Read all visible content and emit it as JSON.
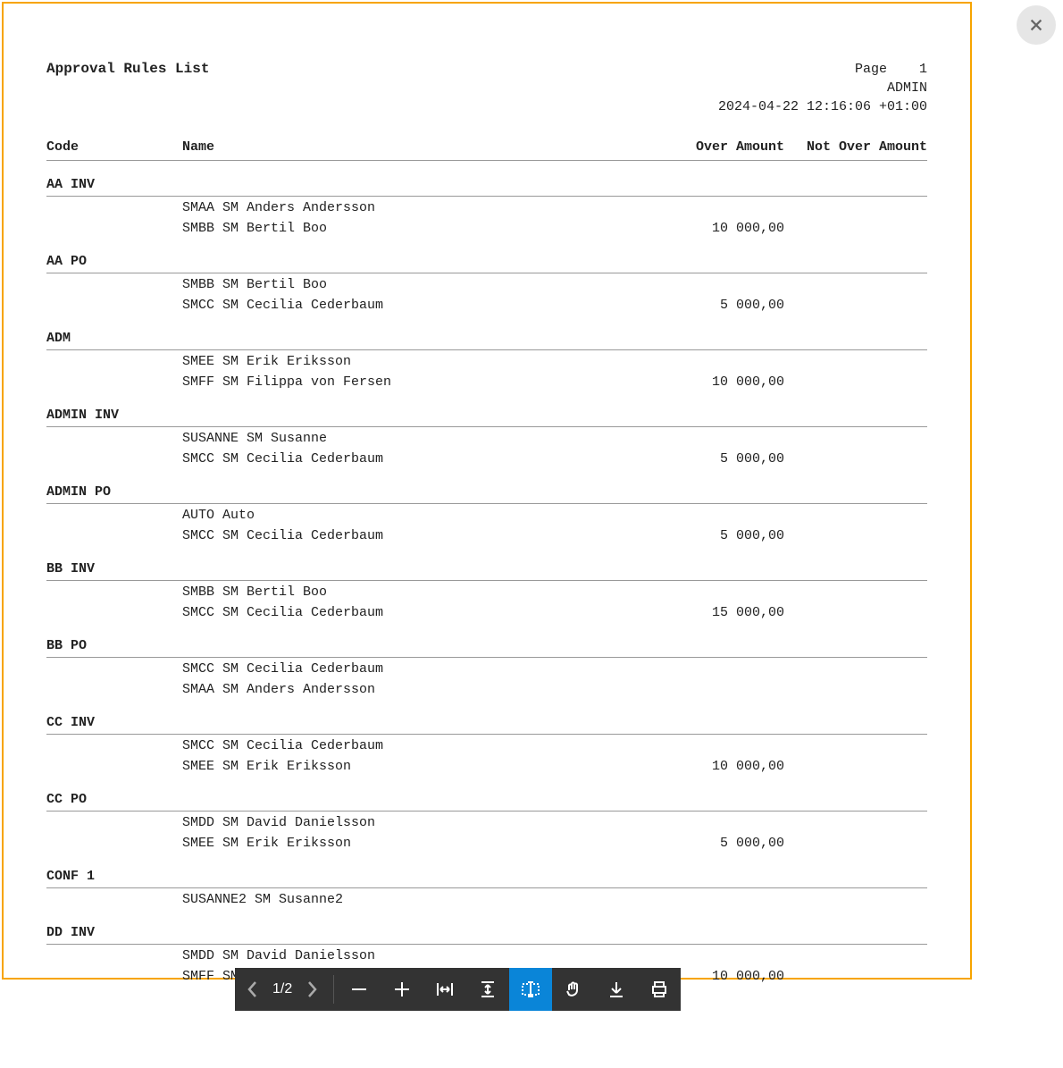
{
  "header": {
    "title": "Approval Rules List",
    "page_label": "Page",
    "page_number": "1",
    "user": "ADMIN",
    "timestamp": "2024-04-22 12:16:06 +01:00"
  },
  "columns": {
    "code": "Code",
    "name": "Name",
    "over": "Over Amount",
    "notover": "Not Over Amount"
  },
  "groups": [
    {
      "code": "AA INV",
      "rows": [
        {
          "name": "SMAA SM Anders Andersson",
          "over": ""
        },
        {
          "name": "SMBB SM Bertil Boo",
          "over": "10 000,00"
        }
      ]
    },
    {
      "code": "AA PO",
      "rows": [
        {
          "name": "SMBB SM Bertil Boo",
          "over": ""
        },
        {
          "name": "SMCC SM Cecilia Cederbaum",
          "over": "5 000,00"
        }
      ]
    },
    {
      "code": "ADM",
      "rows": [
        {
          "name": "SMEE SM Erik Eriksson",
          "over": ""
        },
        {
          "name": "SMFF SM Filippa von Fersen",
          "over": "10 000,00"
        }
      ]
    },
    {
      "code": "ADMIN INV",
      "rows": [
        {
          "name": "SUSANNE SM Susanne",
          "over": ""
        },
        {
          "name": "SMCC SM Cecilia Cederbaum",
          "over": "5 000,00"
        }
      ]
    },
    {
      "code": "ADMIN PO",
      "rows": [
        {
          "name": "AUTO Auto",
          "over": ""
        },
        {
          "name": "SMCC SM Cecilia Cederbaum",
          "over": "5 000,00"
        }
      ]
    },
    {
      "code": "BB INV",
      "rows": [
        {
          "name": "SMBB SM Bertil Boo",
          "over": ""
        },
        {
          "name": "SMCC SM Cecilia Cederbaum",
          "over": "15 000,00"
        }
      ]
    },
    {
      "code": "BB PO",
      "rows": [
        {
          "name": "SMCC SM Cecilia Cederbaum",
          "over": ""
        },
        {
          "name": "SMAA SM Anders Andersson",
          "over": ""
        }
      ]
    },
    {
      "code": "CC INV",
      "rows": [
        {
          "name": "SMCC SM Cecilia Cederbaum",
          "over": ""
        },
        {
          "name": "SMEE SM Erik Eriksson",
          "over": "10 000,00"
        }
      ]
    },
    {
      "code": "CC PO",
      "rows": [
        {
          "name": "SMDD SM David Danielsson",
          "over": ""
        },
        {
          "name": "SMEE SM Erik Eriksson",
          "over": "5 000,00"
        }
      ]
    },
    {
      "code": "CONF 1",
      "rows": [
        {
          "name": "SUSANNE2 SM Susanne2",
          "over": ""
        }
      ]
    },
    {
      "code": "DD INV",
      "rows": [
        {
          "name": "SMDD SM David Danielsson",
          "over": ""
        },
        {
          "name": "SMFF SM Filippa von Fersen",
          "over": "10 000,00"
        }
      ]
    }
  ],
  "toolbar": {
    "page_indicator": "1/2"
  }
}
